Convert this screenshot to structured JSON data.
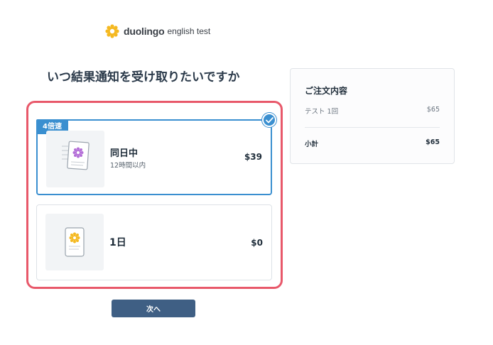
{
  "brand": {
    "name": "duolingo",
    "product": "english test",
    "logo_color": "#f5b921"
  },
  "page": {
    "title": "いつ結果通知を受け取りたいですか"
  },
  "options": [
    {
      "badge": "4倍速",
      "label": "同日中",
      "sublabel": "12時間以内",
      "price": "$39",
      "selected": true,
      "icon": "document-seal-icon"
    },
    {
      "label": "1日",
      "price": "$0",
      "selected": false,
      "icon": "tablet-seal-icon"
    }
  ],
  "actions": {
    "next_label": "次へ"
  },
  "order_summary": {
    "title": "ご注文内容",
    "item_label": "テスト 1回",
    "item_price": "$65",
    "subtotal_label": "小計",
    "subtotal_price": "$65"
  },
  "colors": {
    "accent_blue": "#3a8fd0",
    "highlight_red": "#e8586a",
    "button": "#3f5f84"
  }
}
